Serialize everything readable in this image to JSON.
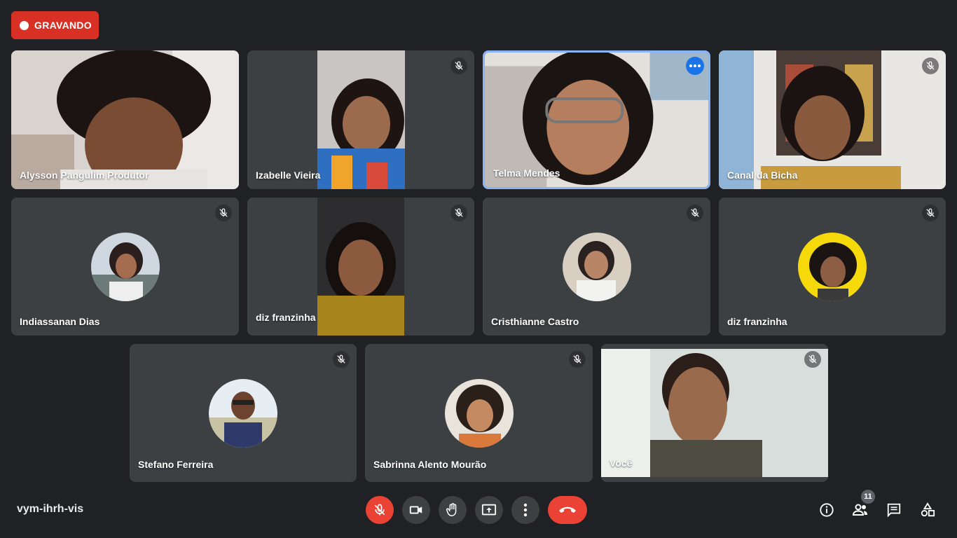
{
  "recording": {
    "label": "GRAVANDO",
    "color": "#d93025"
  },
  "participants": [
    {
      "name": "Alysson Pangulim Produtor",
      "muted": false,
      "video": true
    },
    {
      "name": "Izabelle Vieira",
      "muted": true,
      "video": true
    },
    {
      "name": "Telma Mendes",
      "muted": false,
      "video": true,
      "active_speaker": true
    },
    {
      "name": "Canal da Bicha",
      "muted": true,
      "video": true
    },
    {
      "name": "Indiassanan Dias",
      "muted": true,
      "video": false
    },
    {
      "name": "diz franzinha",
      "muted": true,
      "video": true
    },
    {
      "name": "Cristhianne Castro",
      "muted": true,
      "video": false
    },
    {
      "name": "diz franzinha",
      "muted": true,
      "video": false
    },
    {
      "name": "Stefano Ferreira",
      "muted": true,
      "video": false
    },
    {
      "name": "Sabrinna Alento Mourão",
      "muted": true,
      "video": false
    },
    {
      "name": "Você",
      "muted": true,
      "video": true
    }
  ],
  "meeting": {
    "code": "vym-ihrh-vis"
  },
  "controls": [
    {
      "icon": "mic-off-icon",
      "state": "muted"
    },
    {
      "icon": "camera-icon"
    },
    {
      "icon": "raise-hand-icon"
    },
    {
      "icon": "present-screen-icon"
    },
    {
      "icon": "more-options-icon"
    },
    {
      "icon": "hang-up-icon"
    }
  ],
  "side_controls": {
    "info_icon": "info-icon",
    "people_icon": "people-icon",
    "people_count": "11",
    "chat_icon": "chat-icon",
    "activities_icon": "activities-icon"
  },
  "colors": {
    "background": "#202124",
    "tile": "#3c4043",
    "accent": "#8ab4f8",
    "danger": "#ea4335"
  }
}
